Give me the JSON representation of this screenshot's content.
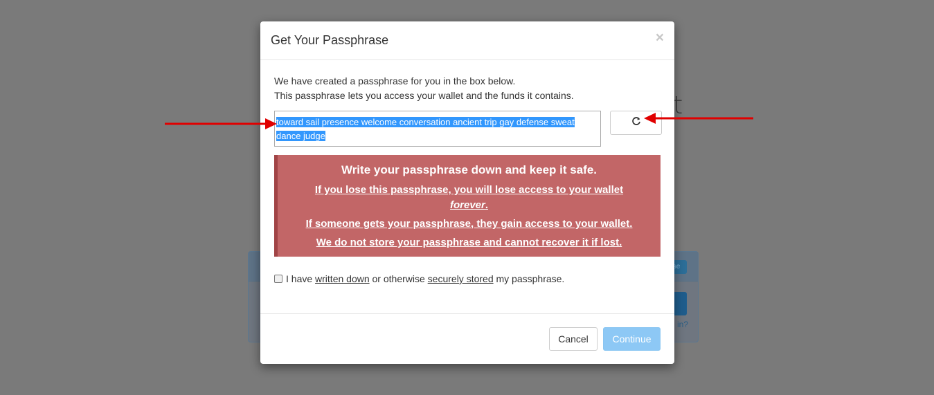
{
  "background": {
    "heading_fragment": "et",
    "panel_link_fragment": "in?"
  },
  "modal": {
    "title": "Get Your Passphrase",
    "close_symbol": "×",
    "intro_line1": "We have created a passphrase for you in the box below.",
    "intro_line2": "This passphrase lets you access your wallet and the funds it contains.",
    "passphrase": "toward sail presence welcome conversation ancient trip gay defense sweat dance judge",
    "refresh_icon": "refresh-icon",
    "warning": {
      "title": "Write your passphrase down and keep it safe.",
      "line1_prefix": "If you lose this passphrase, you will lose access to your wallet ",
      "line1_emphasis": "forever",
      "line1_suffix": ".",
      "line2": "If someone gets your passphrase, they gain access to your wallet.",
      "line3": "We do not store your passphrase and cannot recover it if lost."
    },
    "acknowledgement": {
      "part1": "I have ",
      "link1": "written down",
      "part2": " or otherwise ",
      "link2": "securely stored",
      "part3": " my passphrase.",
      "checked": false
    },
    "buttons": {
      "cancel": "Cancel",
      "continue": "Continue"
    }
  },
  "colors": {
    "overlay": "#7a7a7a",
    "warning_bg": "#c26667",
    "selection": "#3297fd",
    "continue_btn": "#8dc8f5",
    "annotation_arrow": "#e00000"
  }
}
